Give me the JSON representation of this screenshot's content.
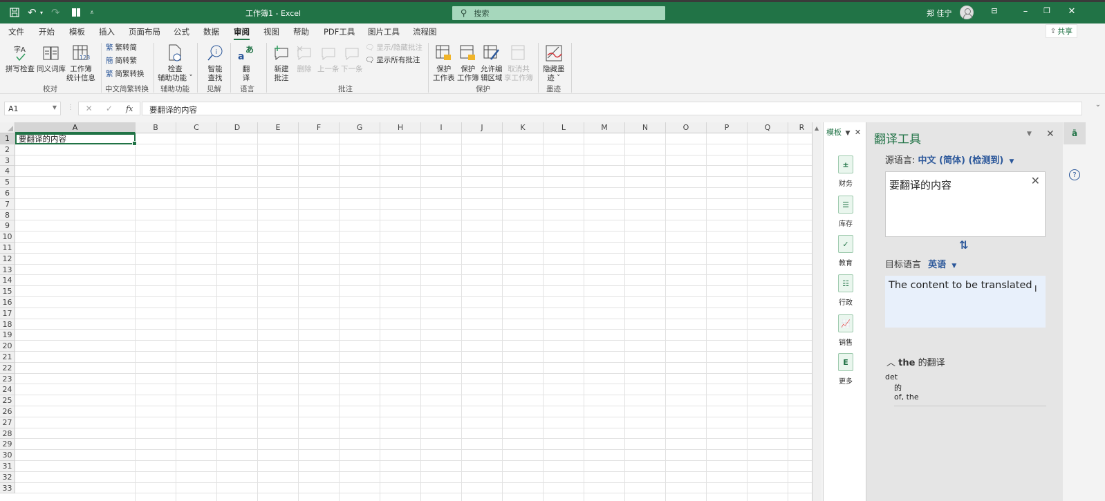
{
  "titlebar": {
    "title": "工作簿1 - Excel",
    "search_placeholder": "搜索",
    "user": "郑 佳宁",
    "save_icon": "save-icon",
    "undo_icon": "undo-icon",
    "redo_icon": "redo-icon",
    "window_controls": [
      "ribbon-display-icon",
      "minimize-icon",
      "restore-icon",
      "close-icon"
    ]
  },
  "tabs": [
    {
      "label": "文件"
    },
    {
      "label": "开始"
    },
    {
      "label": "模板"
    },
    {
      "label": "插入"
    },
    {
      "label": "页面布局"
    },
    {
      "label": "公式"
    },
    {
      "label": "数据"
    },
    {
      "label": "审阅",
      "active": true
    },
    {
      "label": "视图"
    },
    {
      "label": "帮助"
    },
    {
      "label": "PDF工具"
    },
    {
      "label": "图片工具"
    },
    {
      "label": "流程图"
    }
  ],
  "share_label": "共享",
  "ribbon": {
    "proofing": {
      "label": "校对",
      "spell": "拼写检查",
      "thesaurus": "同义词库",
      "stats1": "工作簿",
      "stats2": "统计信息"
    },
    "chinese": {
      "label": "中文简繁转换",
      "t2s": "繁转简",
      "s2t": "简转繁",
      "convert": "简繁转换"
    },
    "access": {
      "label": "辅助功能",
      "check1": "检查",
      "check2": "辅助功能"
    },
    "insights": {
      "label": "见解",
      "smart1": "智能",
      "smart2": "查找"
    },
    "language": {
      "label": "语言",
      "tr1": "翻",
      "tr2": "译"
    },
    "comments": {
      "label": "批注",
      "new1": "新建",
      "new2": "批注",
      "delete": "删除",
      "prev": "上一条",
      "next": "下一条",
      "showhide": "显示/隐藏批注",
      "showall": "显示所有批注"
    },
    "protect": {
      "label": "保护",
      "sheet1": "保护",
      "sheet2": "工作表",
      "book1": "保护",
      "book2": "工作簿",
      "range1": "允许编",
      "range2": "辑区域",
      "unshare1": "取消共",
      "unshare2": "享工作簿"
    },
    "ink": {
      "label": "墨迹",
      "hide1": "隐藏墨",
      "hide2": "迹"
    }
  },
  "formula_bar": {
    "name_box": "A1",
    "value": "要翻译的内容"
  },
  "sheet": {
    "columns": [
      "A",
      "B",
      "C",
      "D",
      "E",
      "F",
      "G",
      "H",
      "I",
      "J",
      "K",
      "L",
      "M",
      "N",
      "O",
      "P",
      "Q",
      "R"
    ],
    "rows": [
      "1",
      "2",
      "3",
      "4",
      "5",
      "6",
      "7",
      "8",
      "9",
      "10",
      "11",
      "12",
      "13",
      "14",
      "15",
      "16",
      "17",
      "18",
      "19",
      "20",
      "21",
      "22",
      "23",
      "24",
      "25",
      "26",
      "27",
      "28",
      "29",
      "30",
      "31",
      "32",
      "33"
    ],
    "selected_cell": "A1",
    "a1_value": "要翻译的内容"
  },
  "templates_pane": {
    "title": "模板",
    "items": [
      {
        "label": "财务",
        "icon": "finance-icon"
      },
      {
        "label": "库存",
        "icon": "inventory-icon"
      },
      {
        "label": "教育",
        "icon": "education-icon"
      },
      {
        "label": "行政",
        "icon": "admin-icon"
      },
      {
        "label": "销售",
        "icon": "sales-icon"
      },
      {
        "label": "更多",
        "icon": "more-icon"
      }
    ]
  },
  "translator": {
    "title": "翻译工具",
    "source_label": "源语言:",
    "source_lang": "中文 (简体) (检测到)",
    "source_text": "要翻译的内容",
    "target_label": "目标语言",
    "target_lang": "英语",
    "target_text": "The content to be translated",
    "dict_word": "the",
    "dict_suffix": "的翻译",
    "dict_pos": "det",
    "dict_zh": "的",
    "dict_en": "of, the"
  },
  "colors": {
    "accent": "#217346",
    "link": "#2b579a"
  }
}
